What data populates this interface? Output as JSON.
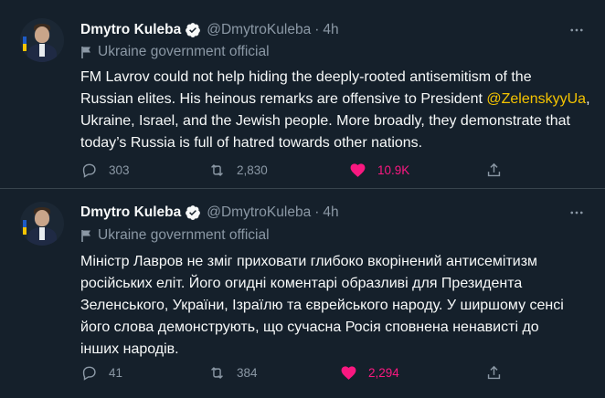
{
  "tweets": [
    {
      "author_name": "Dmytro Kuleba",
      "handle": "@DmytroKuleba",
      "separator": "·",
      "time": "4h",
      "affiliation": "Ukraine government official",
      "text_before": "FM Lavrov could not help hiding the deeply-rooted antisemitism of the\nRussian elites. His heinous remarks are offensive to President ",
      "mention": "@ZelenskyyUa",
      "text_after": ",\nUkraine, Israel, and the Jewish people. More broadly, they demonstrate that\ntoday’s Russia is full of hatred towards other nations.",
      "replies": "303",
      "retweets": "2,830",
      "likes": "10.9K",
      "liked": true
    },
    {
      "author_name": "Dmytro Kuleba",
      "handle": "@DmytroKuleba",
      "separator": "·",
      "time": "4h",
      "affiliation": "Ukraine government official",
      "text": "Міністр Лавров не зміг приховати глибоко вкорінений антисемітизм\nросійських еліт. Його огидні коментарі образливі для Президента\nЗеленського, України, Ізраїлю та єврейського народу. У ширшому сенсі\nйого слова демонструють, що сучасна Росія сповнена ненависті до\nінших народів.",
      "replies": "41",
      "retweets": "384",
      "likes": "2,294",
      "liked": true
    }
  ],
  "colors": {
    "background": "#15202b",
    "text": "#f7f9f9",
    "secondary": "#8b98a5",
    "like": "#f91880",
    "mention": "#f5c400",
    "verified": "#f7f9f9"
  },
  "icons": [
    "verified-badge-icon",
    "more-icon",
    "government-flag-icon",
    "reply-icon",
    "retweet-icon",
    "like-icon",
    "share-icon"
  ]
}
